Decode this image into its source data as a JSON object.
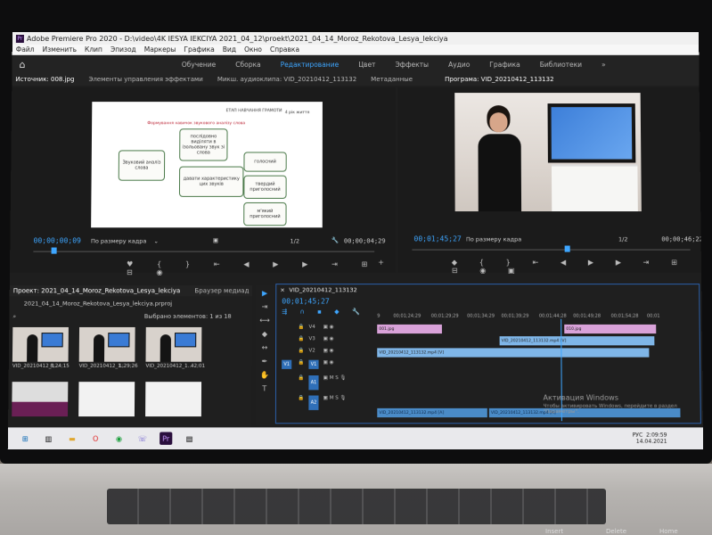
{
  "window": {
    "title": "Adobe Premiere Pro 2020 - D:\\video\\4K IESYA IEKCIYA 2021_04_12\\proekt\\2021_04_14_Moroz_Rekotova_Lesya_lekciya"
  },
  "menu": [
    "Файл",
    "Изменить",
    "Клип",
    "Эпизод",
    "Маркеры",
    "Графика",
    "Вид",
    "Окно",
    "Справка"
  ],
  "workspaces": {
    "items": [
      "Обучение",
      "Сборка",
      "Редактирование",
      "Цвет",
      "Эффекты",
      "Аудио",
      "Графика",
      "Библиотеки"
    ],
    "active": "Редактирование",
    "more": "»"
  },
  "source": {
    "tabs": [
      "Источник: 008.jpg",
      "Элементы управления эффектами",
      "Микш. аудиоклипа: VID_20210412_113132",
      "Метаданные"
    ],
    "timecode": "00;00;00;09",
    "fit": "По размеру кадра",
    "ratio": "1/2",
    "duration": "00;00;04;29",
    "slide": {
      "header": "ЕТАП НАВЧАННЯ ГРАМОТИ",
      "header_right": "4 рік життя",
      "subtitle": "Формування навичок звукового аналізу слова",
      "left_box": "Звуковий аналіз слова",
      "top_box": "послідовно виділяти в ізольовану звук зі слова",
      "mid_box": "давати характеристику цих звуків",
      "r1": "голосний",
      "r2": "твердий приголосний",
      "r3": "м'який приголосний"
    }
  },
  "program": {
    "tab": "Програма: VID_20210412_113132",
    "timecode": "00;01;45;27",
    "fit": "По размеру кадра",
    "ratio": "1/2",
    "duration": "00;00;46;22"
  },
  "project": {
    "tabs": [
      "Проект: 2021_04_14_Moroz_Rekotova_Lesya_lekciya",
      "Браузер медиад"
    ],
    "file": "2021_04_14_Moroz_Rekotova_Lesya_lekciya.prproj",
    "search_placeholder": "",
    "selected": "Выбрано элементов: 1 из 18",
    "thumbs": [
      {
        "name": "VID_20210412_1...",
        "dur": "8;24;15"
      },
      {
        "name": "VID_20210412_1...",
        "dur": "1;29;26"
      },
      {
        "name": "VID_20210412_1...",
        "dur": "42;01"
      }
    ]
  },
  "timeline": {
    "tab": "VID_20210412_113132",
    "timecode": "00;01;45;27",
    "ticks": [
      "9",
      "00;01;24;29",
      "00;01;29;29",
      "00;01;34;29",
      "00;01;39;29",
      "00;01;44;28",
      "00;01;49;28",
      "00;01;54;28",
      "00;01"
    ],
    "tracks_v": [
      "V4",
      "V3",
      "V2",
      "V1"
    ],
    "tracks_a": [
      "A1",
      "A2"
    ],
    "clips": {
      "pink1": "001.jpg",
      "pink2": "010.jpg",
      "blue_top": "VID_20210412_113132.mp4 [V]",
      "blue_mid": "VID_20210412_113132.mp4 [V]",
      "audio1": "VID_20210412_113132.mp4 [A]",
      "audio2": "VID_20210412_113132.mp4 [A]"
    },
    "activation_title": "Активация Windows",
    "activation_sub": "Чтобы активировать Windows, перейдите в раздел \"Параметры\"."
  },
  "taskbar": {
    "time": "2:09:59",
    "date": "14.04.2021",
    "lang": "РУС"
  },
  "keyboard": [
    "Insert",
    "Delete",
    "Home"
  ]
}
